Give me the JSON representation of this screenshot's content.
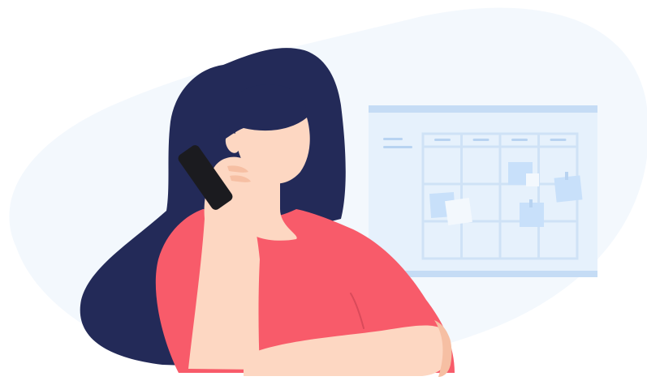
{
  "illustration": {
    "subject": "woman-on-phone",
    "elements": [
      "background-blob",
      "wall-calendar",
      "sticky-notes",
      "woman",
      "phone"
    ],
    "colors": {
      "background_blob": "#F3F8FD",
      "calendar_board": "#E6F1FC",
      "calendar_bar": "#C5DCF5",
      "calendar_grid": "#CFE2F6",
      "calendar_text_lines": "#B8D3F1",
      "sticky_note": "#C8E0FA",
      "sticky_note_light": "#F3F8FD",
      "hair": "#232A58",
      "skin": "#FDD7C2",
      "skin_shadow": "#F6BFA3",
      "shirt": "#F85B6A",
      "shirt_shadow": "#D94A5A",
      "phone": "#1B1B1F"
    }
  }
}
